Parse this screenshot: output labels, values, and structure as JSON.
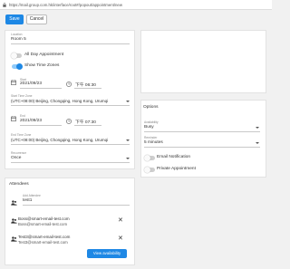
{
  "browser": {
    "url": "https://mail.group.com.hk/interface/root#/popout/appointment/new"
  },
  "toolbar": {
    "save_label": "Save",
    "cancel_label": "Cancel"
  },
  "form": {
    "location": {
      "label": "Location",
      "value": "Room 5"
    },
    "all_day": {
      "label": "All Day Appointment",
      "on": false
    },
    "time_zones": {
      "label": "Show Time Zones",
      "on": true
    },
    "start": {
      "label": "Start",
      "date": "2021/09/23",
      "time": "下午 06:30"
    },
    "start_time_zone": {
      "label": "Start Time Zone",
      "value": "(UTC+08:00) Beijing, Chongqing, Hong Kong, Urumqi"
    },
    "end": {
      "label": "End",
      "date": "2021/09/23",
      "time": "下午 07:30"
    },
    "end_time_zone": {
      "label": "End Time Zone",
      "value": "(UTC+08:00) Beijing, Chongqing, Hong Kong, Urumqi"
    },
    "recurrence": {
      "label": "Recurrence",
      "value": "Once"
    }
  },
  "options": {
    "title": "Options",
    "availability": {
      "label": "Availability",
      "value": "Busy"
    },
    "reminder": {
      "label": "Reminder",
      "value": "5 minutes"
    },
    "email_notification": {
      "label": "Email Notification",
      "on": false
    },
    "private_appointment": {
      "label": "Private Appointment",
      "on": false
    }
  },
  "attendees": {
    "title": "Attendees",
    "add": {
      "label": "Add Attendee",
      "value": "test1"
    },
    "list": [
      {
        "name": "Boss@smart-email-test.com",
        "email": "Boss@smart-email-test.com"
      },
      {
        "name": "Test3@smart-email-test.com",
        "email": "Test3@smart-email-test.com"
      }
    ],
    "view_availability_label": "View availability"
  },
  "colors": {
    "accent": "#1e88e5",
    "toggle_track_on": "#90caf9",
    "background": "#f1f1f1"
  }
}
